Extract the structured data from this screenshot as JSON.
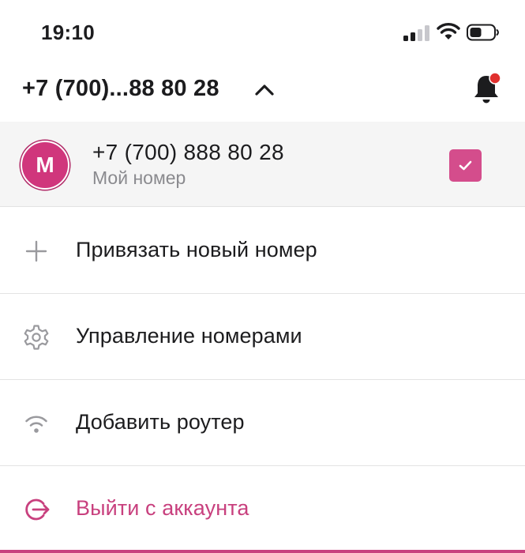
{
  "status_bar": {
    "time": "19:10",
    "icons": [
      "cellular-signal-icon",
      "wifi-icon",
      "battery-icon"
    ]
  },
  "header": {
    "phone": "+7 (700)...88 80 28",
    "icons": [
      "chevron-up-icon",
      "bell-icon"
    ],
    "notification_dot_color": "#e0302e"
  },
  "account": {
    "avatar_letter": "M",
    "number": "+7 (700) 888 80 28",
    "subtitle": "Мой номер",
    "selected": true
  },
  "menu": {
    "items": [
      {
        "label": "Привязать новый номер",
        "icon": "plus-icon"
      },
      {
        "label": "Управление номерами",
        "icon": "gear-icon"
      },
      {
        "label": "Добавить роутер",
        "icon": "wifi-icon"
      },
      {
        "label": "Выйти с аккаунта",
        "icon": "logout-icon"
      }
    ]
  },
  "colors": {
    "accent": "#d0367c",
    "muted_text": "#8a8a8e",
    "icon_gray": "#9a9a9e",
    "divider": "#e3e3e3",
    "selected_row_bg": "#f5f5f5"
  }
}
